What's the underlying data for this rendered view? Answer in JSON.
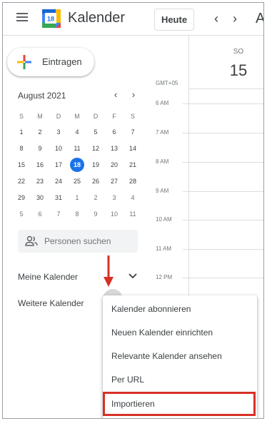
{
  "header": {
    "app_title": "Kalender",
    "logo_day": "18",
    "today_label": "Heute",
    "prev_symbol": "‹",
    "next_symbol": "›",
    "month_label": "A"
  },
  "sidebar": {
    "create_label": "Eintragen",
    "mini_calendar": {
      "title": "August 2021",
      "prev_symbol": "‹",
      "next_symbol": "›",
      "weekdays": [
        "S",
        "M",
        "D",
        "M",
        "D",
        "F",
        "S"
      ],
      "weeks": [
        [
          "1",
          "2",
          "3",
          "4",
          "5",
          "6",
          "7"
        ],
        [
          "8",
          "9",
          "10",
          "11",
          "12",
          "13",
          "14"
        ],
        [
          "15",
          "16",
          "17",
          "18",
          "19",
          "20",
          "21"
        ],
        [
          "22",
          "23",
          "24",
          "25",
          "26",
          "27",
          "28"
        ],
        [
          "29",
          "30",
          "31",
          "1",
          "2",
          "3",
          "4"
        ],
        [
          "5",
          "6",
          "7",
          "8",
          "9",
          "10",
          "11"
        ]
      ],
      "today": "18"
    },
    "people_search_placeholder": "Personen suchen",
    "my_calendars_label": "Meine Kalender",
    "other_calendars_label": "Weitere Kalender"
  },
  "day_view": {
    "day_name": "SO",
    "day_number": "15",
    "timezone": "GMT+05",
    "hours": [
      "6 AM",
      "7 AM",
      "8 AM",
      "9 AM",
      "10 AM",
      "11 AM",
      "12 PM"
    ]
  },
  "menu": {
    "items": [
      "Kalender abonnieren",
      "Neuen Kalender einrichten",
      "Relevante Kalender ansehen",
      "Per URL",
      "Importieren"
    ],
    "highlighted": "Importieren"
  },
  "colors": {
    "accent": "#1a73e8",
    "highlight": "#d93025",
    "arrow": "#d93025"
  }
}
